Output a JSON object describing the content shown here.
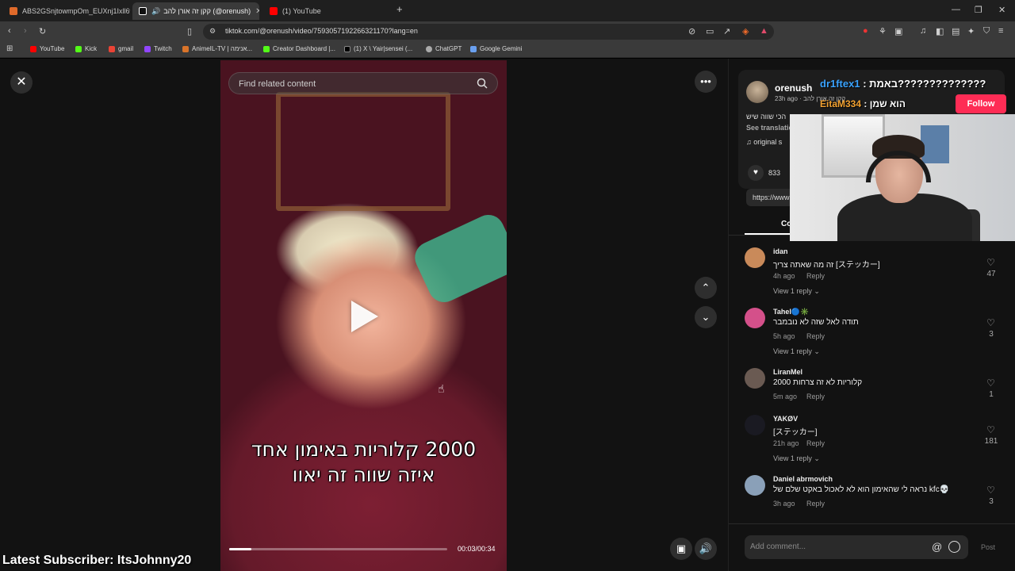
{
  "browser": {
    "tabs": [
      {
        "label": "ABS2GSnjtowmpOm_EUXnj1Ixll6wK..."
      },
      {
        "label": "קקן זה אורן להב (@orenush)"
      },
      {
        "label": "(1) YouTube"
      }
    ],
    "new_tab": "+",
    "url": "tiktok.com/@orenush/video/7593057192266321170?lang=en",
    "bookmarks": [
      {
        "label": "YouTube"
      },
      {
        "label": "Kick"
      },
      {
        "label": "gmail"
      },
      {
        "label": "Twitch"
      },
      {
        "label": "AnimeIL-TV | אנימה..."
      },
      {
        "label": "Creator Dashboard |..."
      },
      {
        "label": "(1) X \\ Yair|sensei (..."
      },
      {
        "label": "ChatGPT"
      },
      {
        "label": "Google Gemini"
      }
    ]
  },
  "player": {
    "search_placeholder": "Find related content",
    "caption_line1": "2000 קלוריות באימון אחד",
    "caption_line2": "איזה שווה זה יאוו",
    "timecode": "00:03/00:34",
    "progress": 0.1
  },
  "author": {
    "name": "orenush",
    "subtitle": "קקן זה אורן להב · 23h ago",
    "description": "הכי שווה שיש",
    "see_translation": "See translation",
    "music": "original s",
    "follow": "Follow"
  },
  "stats": {
    "likes": "833",
    "link": "https://www"
  },
  "comments_tab": "Co",
  "comments": [
    {
      "user": "idan",
      "text": "זה מה שאתה צריך [ステッカー]",
      "time": "4h ago",
      "reply": "Reply",
      "view": "View 1 reply ⌄",
      "likes": "47",
      "avatar_color": "#c98a5a"
    },
    {
      "user": "Tahel🔵✳️",
      "text": "תודה לאל שזה לא נובמבר",
      "time": "5h ago",
      "reply": "Reply",
      "view": "View 1 reply ⌄",
      "likes": "3",
      "avatar_color": "#d4508a"
    },
    {
      "user": "LiranMel",
      "text": "2000 קלוריות לא זה צרחות",
      "time": "5m ago",
      "reply": "Reply",
      "view": "",
      "likes": "1",
      "avatar_color": "#6a5a52"
    },
    {
      "user": "YAKØV",
      "text": "[ステッカー]",
      "time": "21h ago",
      "reply": "Reply",
      "view": "View 1 reply ⌄",
      "likes": "181",
      "avatar_color": "#1a1a22"
    },
    {
      "user": "Daniel abrmovich",
      "text": "נראה לי שהאימון הוא לא לאכול באקט שלם של kfc💀",
      "time": "3h ago",
      "reply": "Reply",
      "view": "",
      "likes": "3",
      "avatar_color": "#8aa0b8"
    }
  ],
  "comment_bar": {
    "placeholder": "Add comment...",
    "post": "Post"
  },
  "overlay": {
    "chat1_user": "dr1ftex1",
    "chat1_text": ": באמת??????????????",
    "chat2_user": "EitaM334",
    "chat2_text": ": הוא שמן",
    "subscriber": "Latest Subscriber: ItsJohnny20"
  },
  "icons": {
    "close": "close-icon",
    "more": "more-icon",
    "up": "chevron-up-icon",
    "down": "chevron-down-icon",
    "volume": "volume-icon",
    "heart": "heart-icon"
  },
  "colors": {
    "follow": "#fe2c55",
    "chat_user_1": "#3aa3ff",
    "chat_user_2": "#f2a130"
  }
}
